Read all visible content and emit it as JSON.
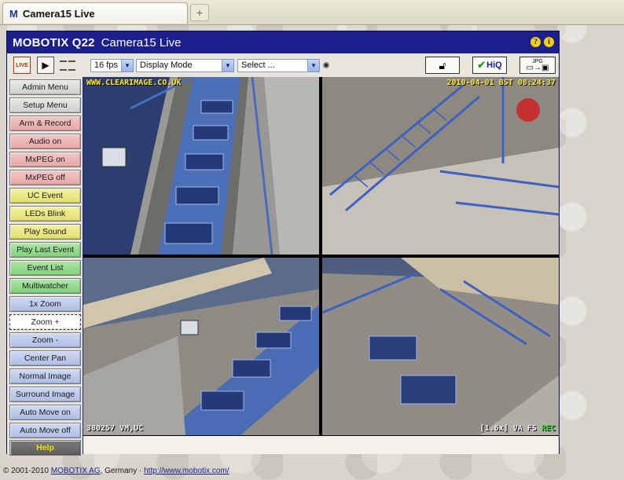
{
  "browser": {
    "tab_title": "Camera15 Live",
    "tab_icon": "M",
    "new_tab_symbol": "+"
  },
  "app": {
    "brand": "MOBOTIX Q22",
    "camera_name": "Camera15 Live",
    "header_icons": [
      "?",
      "i"
    ]
  },
  "toolbar": {
    "live_label": "LIVE",
    "fps": "16 fps",
    "display_mode": "Display Mode",
    "select": "Select ...",
    "hiq_label": "HiQ",
    "jpg_label": "JPG"
  },
  "menu": {
    "items": [
      {
        "label": "Admin Menu",
        "color": "grey"
      },
      {
        "label": "Setup Menu",
        "color": "grey"
      },
      {
        "label": "Arm & Record",
        "color": "pink"
      },
      {
        "label": "Audio on",
        "color": "pink"
      },
      {
        "label": "MxPEG on",
        "color": "pink"
      },
      {
        "label": "MxPEG off",
        "color": "pink"
      },
      {
        "label": "UC Event",
        "color": "yellow"
      },
      {
        "label": "LEDs Blink",
        "color": "yellow"
      },
      {
        "label": "Play Sound",
        "color": "yellow"
      },
      {
        "label": "Play Last Event",
        "color": "green"
      },
      {
        "label": "Event List",
        "color": "green"
      },
      {
        "label": "Multiwatcher",
        "color": "green"
      },
      {
        "label": "1x Zoom",
        "color": "blue"
      },
      {
        "label": "Zoom +",
        "color": "selected"
      },
      {
        "label": "Zoom -",
        "color": "blue"
      },
      {
        "label": "Center Pan",
        "color": "blue"
      },
      {
        "label": "Normal Image",
        "color": "blue"
      },
      {
        "label": "Surround Image",
        "color": "blue"
      },
      {
        "label": "Auto Move on",
        "color": "blue"
      },
      {
        "label": "Auto Move off",
        "color": "blue"
      },
      {
        "label": "Help",
        "color": "help"
      }
    ]
  },
  "overlay": {
    "top_left": "WWW.CLEARIMAGE.CO.UK",
    "top_right": "2010-04-01 BST 08:24:37",
    "bottom_left": "380257 VM,UC",
    "bottom_right_prefix": "[1.6x] VA FS",
    "bottom_right_rec": "REC"
  },
  "footer": {
    "copyright": "© 2001-2010",
    "company": "MOBOTIX AG",
    "country": ", Germany · ",
    "url": "http://www.mobotix.com/"
  },
  "colors": {
    "frame_blue": "#1a1f8c",
    "overlay_yellow": "#ffee33",
    "help_text": "#f2e200"
  }
}
